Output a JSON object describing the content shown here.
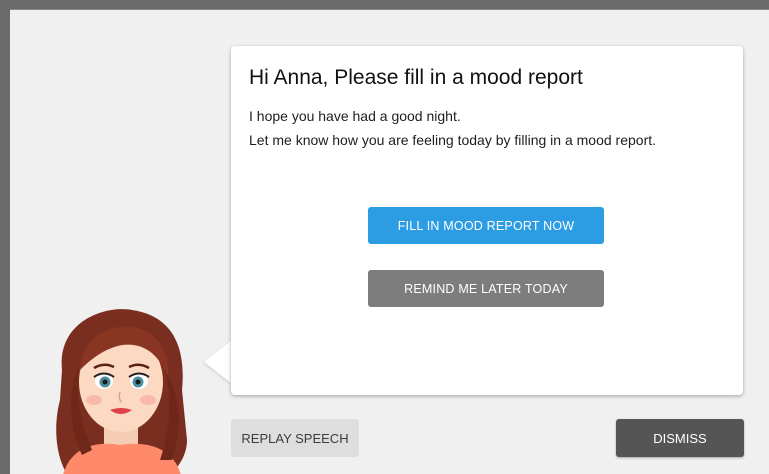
{
  "message": {
    "title": "Hi Anna, Please fill in a mood report",
    "line1": "I hope you have had a good night.",
    "line2": "Let me know how you are feeling today by filling in a mood report."
  },
  "actions": {
    "primary_label": "FILL IN MOOD REPORT NOW",
    "secondary_label": "REMIND ME LATER TODAY"
  },
  "footer": {
    "replay_label": "REPLAY SPEECH",
    "dismiss_label": "DISMISS"
  },
  "colors": {
    "primary": "#2d9de3",
    "secondary": "#7d7d7d",
    "dismiss": "#555555"
  },
  "icons": {
    "assistant": "assistant-avatar-icon"
  }
}
